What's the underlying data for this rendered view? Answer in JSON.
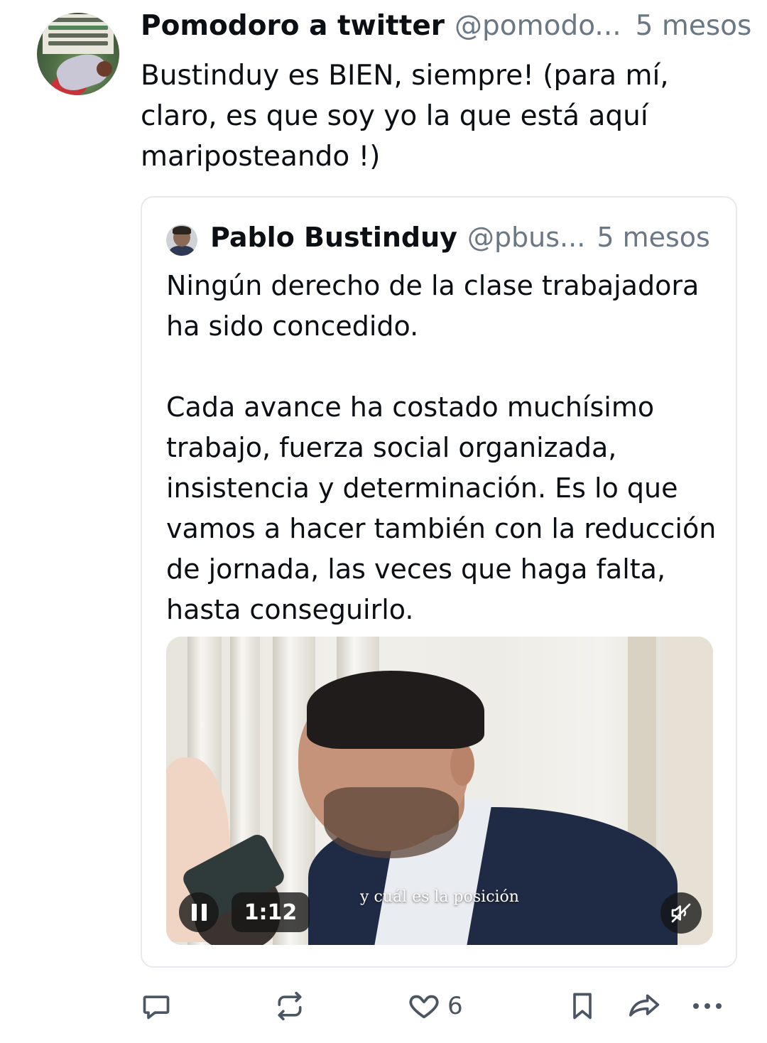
{
  "post": {
    "author": {
      "name": "Pomodoro a twitter",
      "handle": "@pomodo...",
      "time": "5 mesos"
    },
    "text": "Bustinduy es BIEN, siempre! (para mí, claro, es que soy yo la que está aquí mariposteando !)",
    "quote": {
      "author": {
        "name": "Pablo Bustinduy",
        "handle": "@pbus...",
        "time": "5 mesos"
      },
      "text": "Ningún derecho de la clase trabajadora ha sido concedido.\n\nCada avance ha costado muchísimo trabajo, fuerza social organizada, insistencia y determinación. Es lo que vamos a hacer también con la reducción de jornada, las veces que haga falta, hasta conseguirlo.",
      "video": {
        "subtitle": "y cuál es la posición",
        "duration": "1:12",
        "state": "playing",
        "muted": true
      }
    },
    "actions": {
      "reply_icon": "reply-icon",
      "repost_icon": "repost-icon",
      "like_icon": "heart-icon",
      "like_count": "6",
      "bookmark_icon": "bookmark-icon",
      "share_icon": "share-icon",
      "more_icon": "more-icon"
    }
  },
  "colors": {
    "text": "#0b0f14",
    "muted": "#6b7785",
    "icon": "#4b5563",
    "border": "#e6e9ed"
  }
}
